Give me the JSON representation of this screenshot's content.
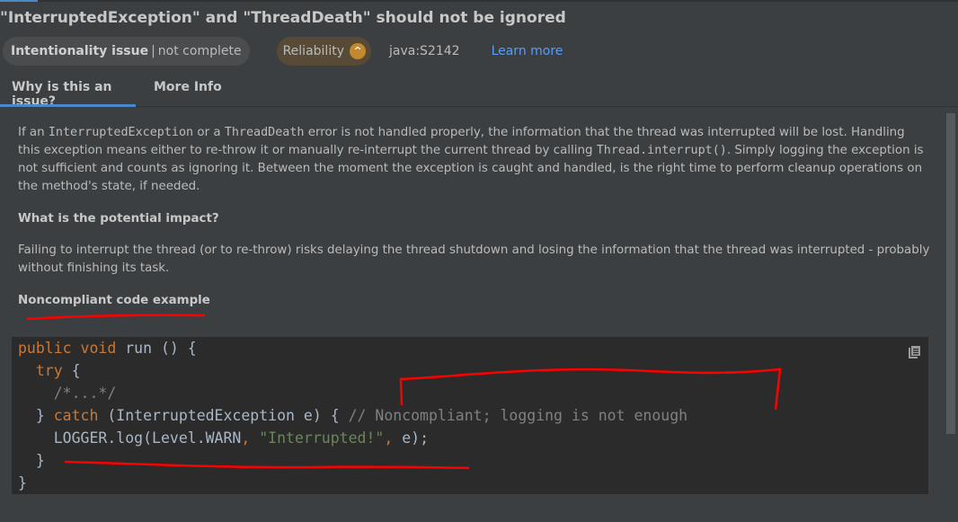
{
  "title": "\"InterruptedException\" and \"ThreadDeath\" should not be ignored",
  "meta": {
    "attribute": "Intentionality issue",
    "separator": "|",
    "attribute_detail": "not complete",
    "quality": "Reliability",
    "severity_icon": "chevron-up-icon",
    "rule_key": "java:S2142",
    "learn_more": "Learn more"
  },
  "tabs": [
    {
      "label": "Why is this an issue?",
      "active": true
    },
    {
      "label": "More Info",
      "active": false
    }
  ],
  "description": {
    "p1_a": "If an ",
    "p1_code1": "InterruptedException",
    "p1_b": " or a ",
    "p1_code2": "ThreadDeath",
    "p1_c": " error is not handled properly, the information that the thread was interrupted will be lost. Handling this exception means either to re-throw it or manually re-interrupt the current thread by calling ",
    "p1_code3": "Thread.interrupt()",
    "p1_d": ". Simply logging the exception is not sufficient and counts as ignoring it. Between the moment the exception is caught and handled, is the right time to perform cleanup operations on the method's state, if needed.",
    "impact_heading": "What is the potential impact?",
    "impact_text": "Failing to interrupt the thread (or to re-throw) risks delaying the thread shutdown and losing the information that the thread was interrupted - probably without finishing its task.",
    "example_heading": "Noncompliant code example"
  },
  "code": {
    "l1_kw": "public void",
    "l1_rest": " run () {",
    "l2_kw": "try",
    "l2_rest": " {",
    "l3_cm": "/*...*/",
    "l4_a": "} ",
    "l4_kw": "catch",
    "l4_b": " (InterruptedException e) { ",
    "l4_cm": "// Noncompliant; logging is not enough",
    "l5_a": "LOGGER.log(Level.WARN",
    "l5_comma": ", ",
    "l5_str": "\"Interrupted!\"",
    "l5_comma2": ",",
    "l5_b": " e);",
    "l6": "}",
    "l7": "}",
    "copy_icon": "copy-icon"
  },
  "colors": {
    "accent": "#4a88c7",
    "link": "#589df6",
    "keyword": "#cc7832",
    "string": "#6a8759",
    "comment": "#808080",
    "annotation": "#ff0000"
  }
}
